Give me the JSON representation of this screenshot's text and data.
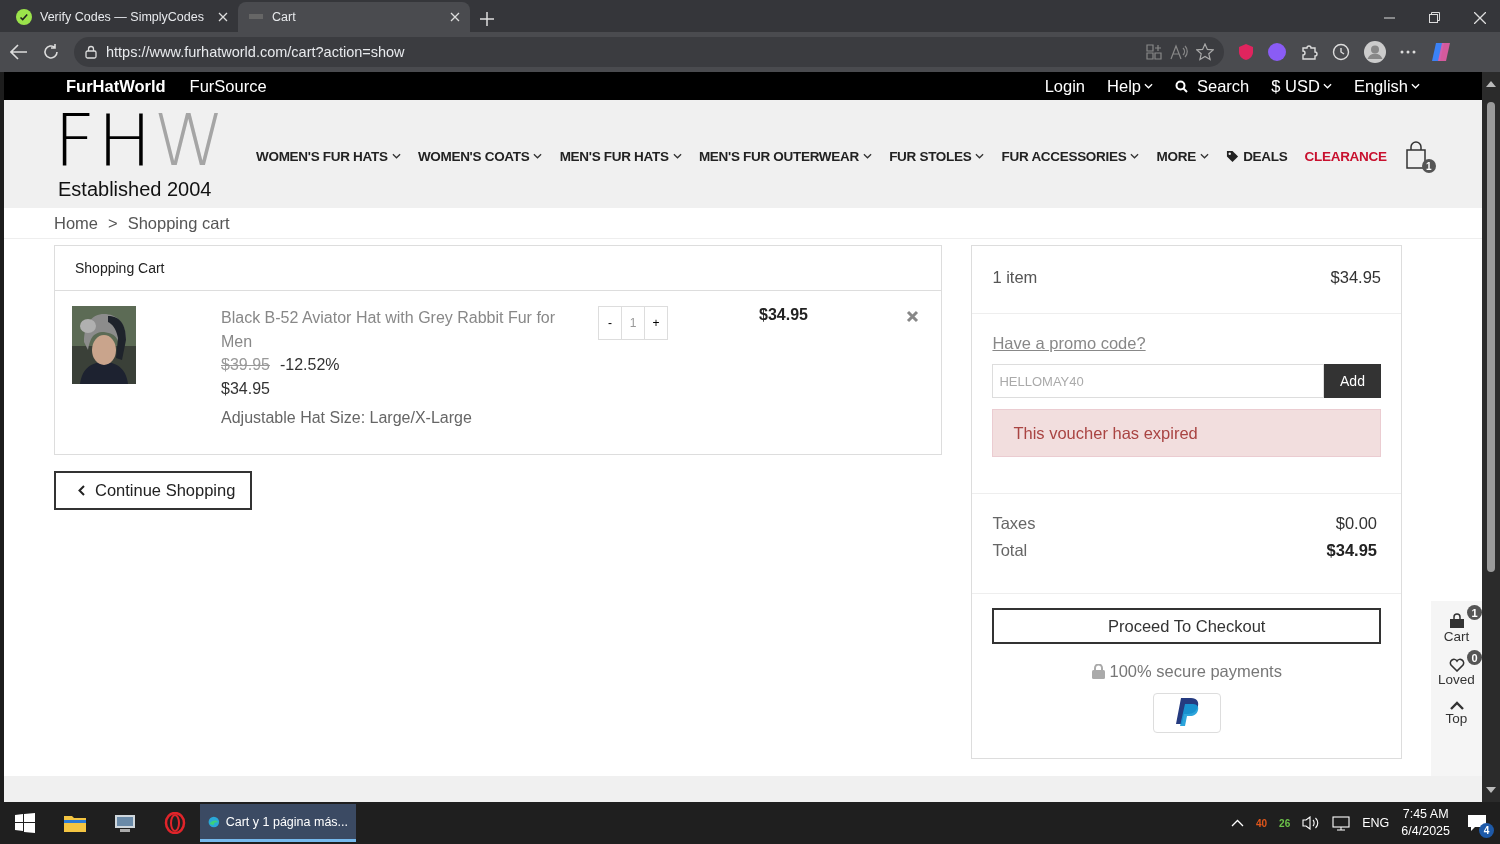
{
  "browser": {
    "tabs": [
      {
        "title": "Verify Codes — SimplyCodes",
        "selected": false
      },
      {
        "title": "Cart",
        "selected": true
      }
    ],
    "url": "https://www.furhatworld.com/cart?action=show"
  },
  "topbar": {
    "brands": [
      "FurHatWorld",
      "FurSource"
    ],
    "links": [
      {
        "label": "Login",
        "kind": "plain"
      },
      {
        "label": "Help",
        "kind": "dropdown"
      },
      {
        "label": "Search",
        "kind": "search"
      },
      {
        "label": "$ USD",
        "kind": "dropdown"
      },
      {
        "label": "English",
        "kind": "dropdown"
      }
    ]
  },
  "header": {
    "logo": {
      "dark": "FH",
      "light": "W"
    },
    "tagline": "Established 2004",
    "nav": [
      {
        "label": "WOMEN'S FUR HATS",
        "kind": "dropdown"
      },
      {
        "label": "WOMEN'S COATS",
        "kind": "dropdown"
      },
      {
        "label": "MEN'S FUR HATS",
        "kind": "dropdown"
      },
      {
        "label": "MEN'S FUR OUTERWEAR",
        "kind": "dropdown"
      },
      {
        "label": "FUR STOLES",
        "kind": "dropdown"
      },
      {
        "label": "FUR ACCESSORIES",
        "kind": "dropdown"
      },
      {
        "label": "MORE",
        "kind": "dropdown"
      },
      {
        "label": "DEALS",
        "kind": "tag"
      },
      {
        "label": "CLEARANCE",
        "kind": "highlight"
      }
    ],
    "cart_count": "1"
  },
  "breadcrumb": [
    "Home",
    ">",
    "Shopping cart"
  ],
  "cart": {
    "title": "Shopping Cart",
    "items": [
      {
        "name": "Black B-52 Aviator Hat with Grey Rabbit Fur for Men",
        "old_price": "$39.95",
        "discount": "-12.52%",
        "price": "$34.95",
        "option": "Adjustable Hat Size: Large/X-Large",
        "minus": "-",
        "quantity": "1",
        "plus": "+",
        "total": "$34.95"
      }
    ],
    "continue": "Continue Shopping"
  },
  "summary": {
    "count": "1 item",
    "subtotal": "$34.95",
    "promo_link": "Have a promo code?",
    "promo_value": "HELLOMAY40",
    "promo_button": "Add",
    "alert": "This voucher has expired",
    "lines": [
      {
        "label": "Taxes",
        "value": "$0.00",
        "bold": false
      },
      {
        "label": "Total",
        "value": "$34.95",
        "bold": true
      }
    ],
    "checkout": "Proceed To Checkout",
    "secure": "100% secure payments"
  },
  "side_widgets": [
    {
      "label": "Cart",
      "badge": "1",
      "kind": "cart"
    },
    {
      "label": "Loved",
      "badge": "0",
      "kind": "heart"
    },
    {
      "label": "Top",
      "kind": "top"
    }
  ],
  "taskbar": {
    "window_title": "Cart y 1 página más...",
    "tray_numbers": [
      {
        "text": "40",
        "color": "#e0561b"
      },
      {
        "text": "26",
        "color": "#6cc24a"
      }
    ],
    "language": "ENG",
    "time": "7:45 AM",
    "date": "6/4/2025",
    "notifications": "4"
  }
}
